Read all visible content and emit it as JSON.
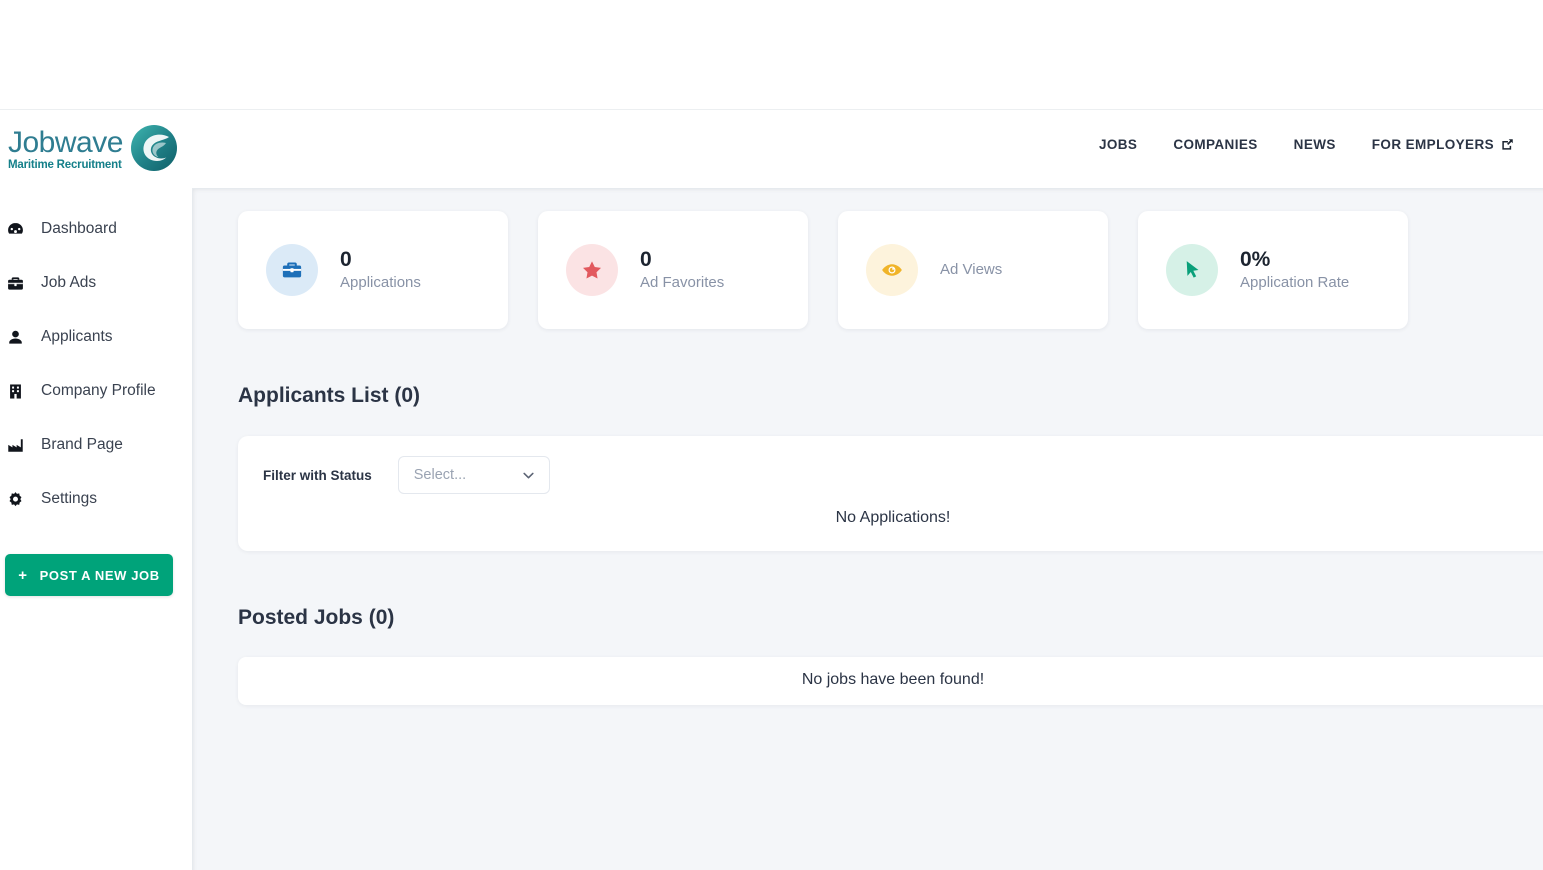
{
  "brand": {
    "name": "Jobwave",
    "tagline": "Maritime Recruitment",
    "logo_icon": "wave-c-logo-icon",
    "primary_color": "#2f7d91",
    "accent_color": "#15808a"
  },
  "header": {
    "nav": [
      {
        "label": "JOBS",
        "icon": null
      },
      {
        "label": "COMPANIES",
        "icon": null
      },
      {
        "label": "NEWS",
        "icon": null
      },
      {
        "label": "FOR EMPLOYERS",
        "icon": "external-link-icon"
      }
    ]
  },
  "sidebar": {
    "items": [
      {
        "label": "Dashboard",
        "icon": "speedometer-icon"
      },
      {
        "label": "Job Ads",
        "icon": "briefcase-icon"
      },
      {
        "label": "Applicants",
        "icon": "person-icon"
      },
      {
        "label": "Company Profile",
        "icon": "building-icon"
      },
      {
        "label": "Brand Page",
        "icon": "factory-icon"
      },
      {
        "label": "Settings",
        "icon": "gear-icon"
      }
    ],
    "post_button": {
      "label": "POST A NEW JOB",
      "plus": "+",
      "color": "#00a37a"
    }
  },
  "main": {
    "stats": [
      {
        "value": "0",
        "label": "Applications",
        "icon": "briefcase-icon",
        "icon_color": "#1d6fb8",
        "circle_color": "#dbeaf7"
      },
      {
        "value": "0",
        "label": "Ad Favorites",
        "icon": "star-icon",
        "icon_color": "#e2595e",
        "circle_color": "#fbe3e4"
      },
      {
        "value": "",
        "label": "Ad Views",
        "icon": "eye-icon",
        "icon_color": "#f0b429",
        "circle_color": "#fdf3dc"
      },
      {
        "value": "0%",
        "label": "Application Rate",
        "icon": "cursor-arrow-icon",
        "icon_color": "#0aa07a",
        "circle_color": "#d6f1e7"
      }
    ],
    "applicants_section": {
      "title": "Applicants List (0)",
      "filter_label": "Filter with Status",
      "filter_placeholder": "Select...",
      "empty_message": "No Applications!"
    },
    "jobs_section": {
      "title": "Posted Jobs (0)",
      "empty_message": "No jobs have been found!"
    }
  }
}
